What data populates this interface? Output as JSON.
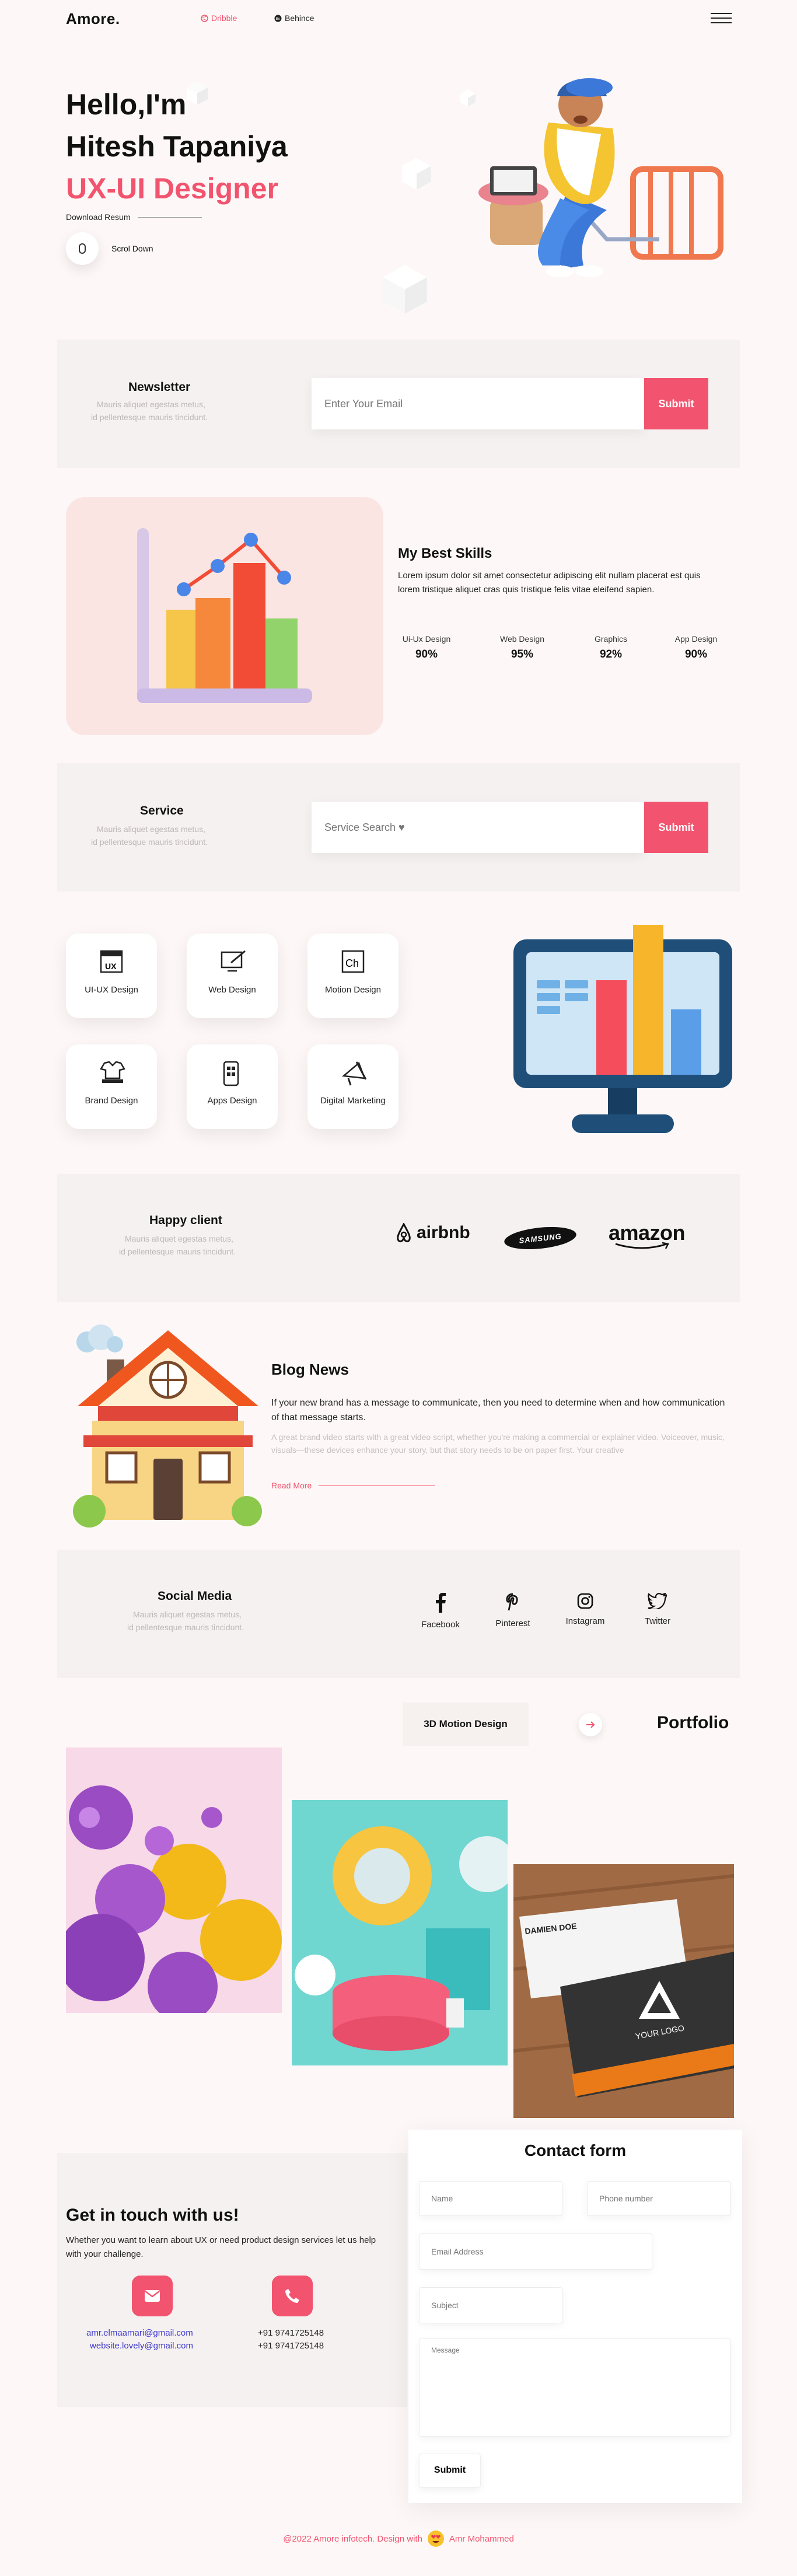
{
  "nav": {
    "brand": "Amore.",
    "links": [
      "Dribble",
      "Behince"
    ]
  },
  "hero": {
    "greeting": "Hello,I'm",
    "name": "Hitesh Tapaniya",
    "role": "UX-UI Designer",
    "download": "Download Resum",
    "scroll": "Scrol Down"
  },
  "newsletter": {
    "title": "Newsletter",
    "desc1": "Mauris aliquet egestas metus,",
    "desc2": "id pellentesque mauris tincidunt.",
    "placeholder": "Enter Your Email",
    "button": "Submit"
  },
  "skills": {
    "title": "My Best Skills",
    "desc": "Lorem ipsum dolor sit amet consectetur adipiscing elit nullam placerat est quis lorem tristique aliquet cras quis tristique felis vitae eleifend sapien.",
    "items": [
      {
        "label": "Ui-Ux Design",
        "value": "90%"
      },
      {
        "label": "Web Design",
        "value": "95%"
      },
      {
        "label": "Graphics",
        "value": "92%"
      },
      {
        "label": "App Design",
        "value": "90%"
      }
    ]
  },
  "service": {
    "title": "Service",
    "desc1": "Mauris aliquet egestas metus,",
    "desc2": "id pellentesque mauris tincidunt.",
    "placeholder": "Service Search ♥",
    "button": "Submit",
    "cards": [
      {
        "label": "UI-UX Design",
        "icon": "ux-icon"
      },
      {
        "label": "Web Design",
        "icon": "web-design-icon"
      },
      {
        "label": "Motion Design",
        "icon": "motion-icon"
      },
      {
        "label": "Brand Design",
        "icon": "brand-icon"
      },
      {
        "label": "Apps Design",
        "icon": "apps-icon"
      },
      {
        "label": "Digital Marketing",
        "icon": "megaphone-icon"
      }
    ]
  },
  "clients": {
    "title": "Happy client",
    "desc1": "Mauris aliquet egestas metus,",
    "desc2": "id pellentesque mauris tincidunt.",
    "logos": [
      "airbnb",
      "SAMSUNG",
      "amazon"
    ]
  },
  "blog": {
    "title": "Blog News",
    "lead": "If your new brand has a message to communicate, then you need to determine when and how communication of that message starts.",
    "body": "A great brand video starts with a great video script, whether you're making a commercial or explainer video. Voiceover, music, visuals—these devices enhance your story, but that story needs to be on paper first. Your creative",
    "more": "Read More"
  },
  "social": {
    "title": "Social Media",
    "desc1": "Mauris aliquet egestas metus,",
    "desc2": "id pellentesque mauris tincidunt.",
    "items": [
      "Facebook",
      "Pinterest",
      "Instagram",
      "Twitter"
    ]
  },
  "portfolio": {
    "tag": "3D Motion Design",
    "title": "Portfolio",
    "card_text": "DAMIEN DOE",
    "logo_text": "YOUR LOGO"
  },
  "contact": {
    "title": "Contact form",
    "name": "Name",
    "phone": "Phone number",
    "email": "Email Address",
    "subject": "Subject",
    "message": "Message",
    "submit": "Submit",
    "touch_title": "Get in touch with us!",
    "touch_desc": "Whether you want to learn about UX or need product design services let us help with your challenge.",
    "email1": "amr.elmaamari@gmail.com",
    "email2": "website.lovely@gmail.com",
    "phone1": "+91 9741725148",
    "phone2": "+91 9741725148"
  },
  "footer": {
    "left": "@2022 Amore infotech. Design with",
    "right": "Amr Mohammed"
  },
  "colors": {
    "accent": "#f2546f",
    "bg": "#fdf8f7",
    "panel": "#f6f1f1",
    "link": "#3c38c9"
  }
}
